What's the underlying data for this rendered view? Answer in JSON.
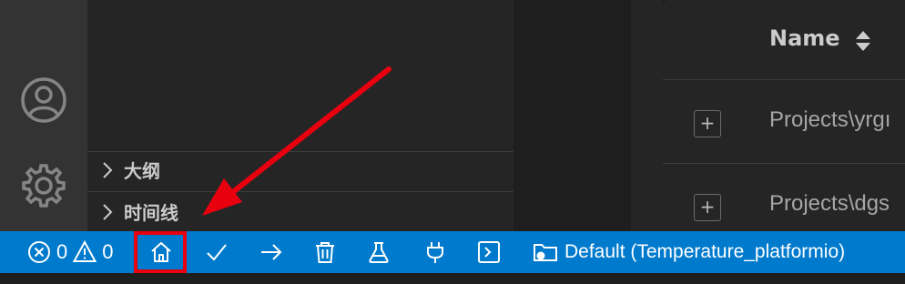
{
  "activity_bar": {
    "icons": [
      "account-icon",
      "gear-icon"
    ]
  },
  "side_panel": {
    "sections": [
      {
        "label": "大纲"
      },
      {
        "label": "时间线"
      }
    ]
  },
  "table": {
    "column_header": "Name",
    "rows": [
      {
        "text": "Projects\\yrgı"
      },
      {
        "text": "Projects\\dgs"
      }
    ],
    "expand_symbol": "+"
  },
  "status_bar": {
    "errors_count": "0",
    "warnings_count": "0",
    "environment_label": "Default (Temperature_platformio)",
    "buttons": [
      "home-icon",
      "check-icon",
      "arrow-right-icon",
      "trash-icon",
      "flask-icon",
      "plug-icon",
      "terminal-icon",
      "folder-env-icon"
    ]
  },
  "colors": {
    "status_bar_bg": "#007acc",
    "annotation_red": "#e8000f"
  }
}
